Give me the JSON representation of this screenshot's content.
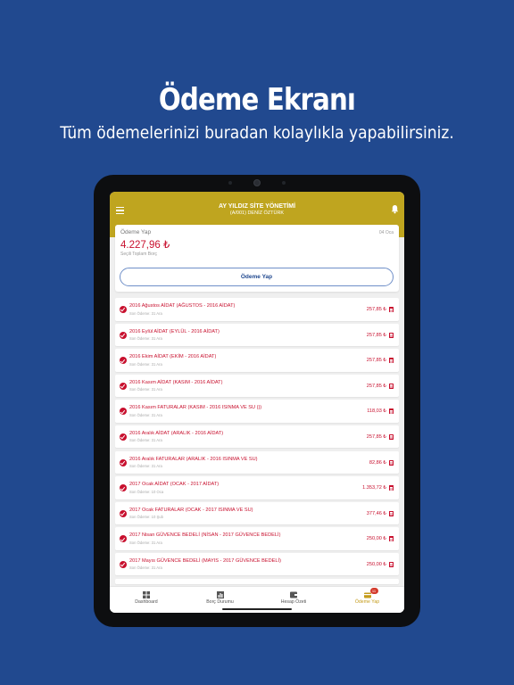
{
  "promo": {
    "title": "Ödeme Ekranı",
    "subtitle": "Tüm ödemelerinizi buradan kolaylıkla yapabilirsiniz."
  },
  "header": {
    "title": "AY YILDIZ SİTE YÖNETİMİ",
    "subtitle": "(A/001) DENİZ ÖZTÜRK"
  },
  "payment_card": {
    "label": "Ödeme Yap",
    "date": "04 Oca",
    "amount": "4.227,96 ₺",
    "note": "Seçili Toplam Borç",
    "button_label": "Ödeme Yap"
  },
  "items": [
    {
      "title": "2016 Ağustos AİDAT (AĞUSTOS - 2016 AİDAT)",
      "due": "Son Ödeme: 31 Ara",
      "amount": "257,85 ₺"
    },
    {
      "title": "2016 Eylül AİDAT (EYLÜL - 2016 AİDAT)",
      "due": "Son Ödeme: 31 Ara",
      "amount": "257,85 ₺"
    },
    {
      "title": "2016 Ekim AİDAT (EKİM - 2016 AİDAT)",
      "due": "Son Ödeme: 31 Ara",
      "amount": "257,85 ₺"
    },
    {
      "title": "2016 Kasım AİDAT (KASIM - 2016 AİDAT)",
      "due": "Son Ödeme: 31 Ara",
      "amount": "257,85 ₺"
    },
    {
      "title": "2016 Kasım FATURALAR (KASIM - 2016 ISINMA VE SU ())",
      "due": "Son Ödeme: 31 Ara",
      "amount": "118,03 ₺"
    },
    {
      "title": "2016 Aralık AİDAT (ARALIK - 2016 AİDAT)",
      "due": "Son Ödeme: 31 Ara",
      "amount": "257,85 ₺"
    },
    {
      "title": "2016 Aralık FATURALAR (ARALIK - 2016 ISINMA VE SU)",
      "due": "Son Ödeme: 31 Ara",
      "amount": "82,86 ₺"
    },
    {
      "title": "2017 Ocak AİDAT (OCAK - 2017 AİDAT)",
      "due": "Son Ödeme: 10 Oca",
      "amount": "1.353,72 ₺"
    },
    {
      "title": "2017 Ocak FATURALAR (OCAK - 2017 ISINMA VE SU)",
      "due": "Son Ödeme: 10 Şub",
      "amount": "377,46 ₺"
    },
    {
      "title": "2017 Nisan GÜVENCE BEDELİ (NİSAN - 2017 GÜVENCE BEDELİ)",
      "due": "Son Ödeme: 31 Ara",
      "amount": "250,00 ₺"
    },
    {
      "title": "2017 Mayıs GÜVENCE BEDELİ (MAYIS - 2017 GÜVENCE BEDELİ)",
      "due": "Son Ödeme: 31 Ara",
      "amount": "250,00 ₺"
    }
  ],
  "tabs": [
    {
      "label": "Dashboard",
      "icon": "dashboard-icon"
    },
    {
      "label": "Borç Durumu",
      "icon": "chart-icon"
    },
    {
      "label": "Hesap Özeti",
      "icon": "wallet-icon"
    },
    {
      "label": "Ödeme Yap",
      "icon": "payment-icon",
      "badge": "11"
    }
  ],
  "colors": {
    "background": "#21498f",
    "header": "#bfa51f",
    "accent_red": "#c8102e",
    "active_tab": "#c49b1a"
  }
}
